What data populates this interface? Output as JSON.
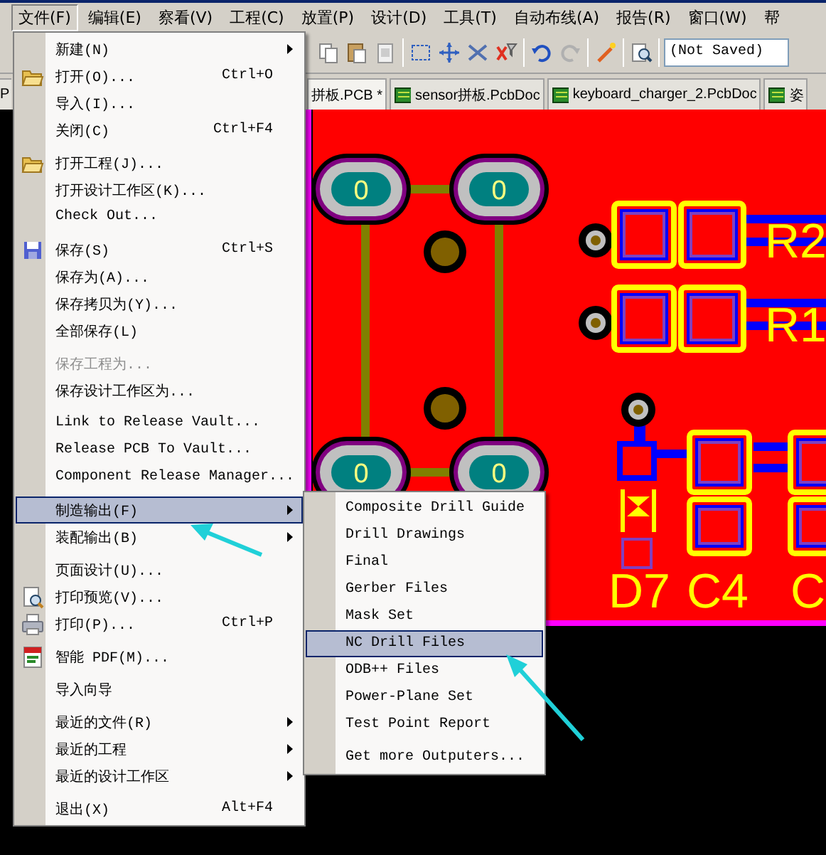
{
  "menubar": [
    {
      "label": "文件(F)",
      "selected": true
    },
    {
      "label": "编辑(E)",
      "selected": false
    },
    {
      "label": "察看(V)",
      "selected": false
    },
    {
      "label": "工程(C)",
      "selected": false
    },
    {
      "label": "放置(P)",
      "selected": false
    },
    {
      "label": "设计(D)",
      "selected": false
    },
    {
      "label": "工具(T)",
      "selected": false
    },
    {
      "label": "自动布线(A)",
      "selected": false
    },
    {
      "label": "报告(R)",
      "selected": false
    },
    {
      "label": "窗口(W)",
      "selected": false
    },
    {
      "label": "帮",
      "selected": false
    }
  ],
  "toolbar": {
    "field": {
      "value": "(Not Saved)"
    }
  },
  "tabs": [
    {
      "label": "P",
      "selected": false,
      "kind": "plain"
    },
    {
      "label": "拼板.PCB *",
      "selected": true,
      "kind": "plain"
    },
    {
      "label": "sensor拼板.PcbDoc",
      "selected": false,
      "kind": "document"
    },
    {
      "label": "keyboard_charger_2.PcbDoc",
      "selected": false,
      "kind": "document"
    },
    {
      "label": "姿",
      "selected": false,
      "kind": "document"
    }
  ],
  "file_menu": {
    "groups": [
      {
        "items": [
          {
            "label": "新建(N)",
            "submenu": true,
            "disabled": false,
            "selected": false
          },
          {
            "label": "打开(O)...",
            "shortcut": "Ctrl+O",
            "submenu": false,
            "disabled": false,
            "selected": false
          },
          {
            "label": "导入(I)...",
            "submenu": false,
            "disabled": false,
            "selected": false
          },
          {
            "label": "关闭(C)",
            "shortcut": "Ctrl+F4",
            "submenu": false,
            "disabled": false,
            "selected": false
          }
        ]
      },
      {
        "items": [
          {
            "label": "打开工程(J)...",
            "submenu": false,
            "disabled": false,
            "selected": false
          },
          {
            "label": "打开设计工作区(K)...",
            "submenu": false,
            "disabled": false,
            "selected": false
          },
          {
            "label": "Check Out...",
            "submenu": false,
            "disabled": false,
            "selected": false
          }
        ]
      },
      {
        "items": [
          {
            "label": "保存(S)",
            "shortcut": "Ctrl+S",
            "submenu": false,
            "disabled": false,
            "selected": false
          },
          {
            "label": "保存为(A)...",
            "submenu": false,
            "disabled": false,
            "selected": false
          },
          {
            "label": "保存拷贝为(Y)...",
            "submenu": false,
            "disabled": false,
            "selected": false
          },
          {
            "label": "全部保存(L)",
            "submenu": false,
            "disabled": false,
            "selected": false
          }
        ]
      },
      {
        "items": [
          {
            "label": "保存工程为...",
            "submenu": false,
            "disabled": true,
            "selected": false
          },
          {
            "label": "保存设计工作区为...",
            "submenu": false,
            "disabled": false,
            "selected": false
          }
        ]
      },
      {
        "items": [
          {
            "label": "Link to Release Vault...",
            "submenu": false,
            "disabled": false,
            "selected": false
          },
          {
            "label": "Release PCB To Vault...",
            "submenu": false,
            "disabled": false,
            "selected": false
          },
          {
            "label": "Component Release Manager...",
            "submenu": false,
            "disabled": false,
            "selected": false
          }
        ]
      },
      {
        "items": [
          {
            "label": "制造输出(F)",
            "submenu": true,
            "disabled": false,
            "selected": true
          },
          {
            "label": "装配输出(B)",
            "submenu": true,
            "disabled": false,
            "selected": false
          }
        ]
      },
      {
        "items": [
          {
            "label": "页面设计(U)...",
            "submenu": false,
            "disabled": false,
            "selected": false
          },
          {
            "label": "打印预览(V)...",
            "submenu": false,
            "disabled": false,
            "selected": false
          },
          {
            "label": "打印(P)...",
            "shortcut": "Ctrl+P",
            "submenu": false,
            "disabled": false,
            "selected": false
          }
        ]
      },
      {
        "items": [
          {
            "label": "智能 PDF(M)...",
            "submenu": false,
            "disabled": false,
            "selected": false
          }
        ]
      },
      {
        "items": [
          {
            "label": "导入向导",
            "submenu": false,
            "disabled": false,
            "selected": false
          }
        ]
      },
      {
        "items": [
          {
            "label": "最近的文件(R)",
            "submenu": true,
            "disabled": false,
            "selected": false
          },
          {
            "label": "最近的工程",
            "submenu": true,
            "disabled": false,
            "selected": false
          },
          {
            "label": "最近的设计工作区",
            "submenu": true,
            "disabled": false,
            "selected": false
          }
        ]
      },
      {
        "items": [
          {
            "label": "退出(X)",
            "shortcut": "Alt+F4",
            "submenu": false,
            "disabled": false,
            "selected": false
          }
        ]
      }
    ]
  },
  "fabrication_submenu": {
    "groups": [
      {
        "items": [
          {
            "label": "Composite Drill Guide",
            "selected": false
          },
          {
            "label": "Drill Drawings",
            "selected": false
          },
          {
            "label": "Final",
            "selected": false
          },
          {
            "label": "Gerber Files",
            "selected": false
          },
          {
            "label": "Mask Set",
            "selected": false
          },
          {
            "label": "NC Drill Files",
            "selected": true
          },
          {
            "label": "ODB++ Files",
            "selected": false
          },
          {
            "label": "Power-Plane Set",
            "selected": false
          },
          {
            "label": "Test Point Report",
            "selected": false
          }
        ]
      },
      {
        "items": [
          {
            "label": "Get more Outputers...",
            "selected": false
          }
        ]
      }
    ]
  },
  "pcb": {
    "pad_labels": [
      "0",
      "0",
      "0",
      "0"
    ],
    "designators": [
      "R2",
      "R1",
      "D7",
      "C4",
      "C"
    ]
  }
}
